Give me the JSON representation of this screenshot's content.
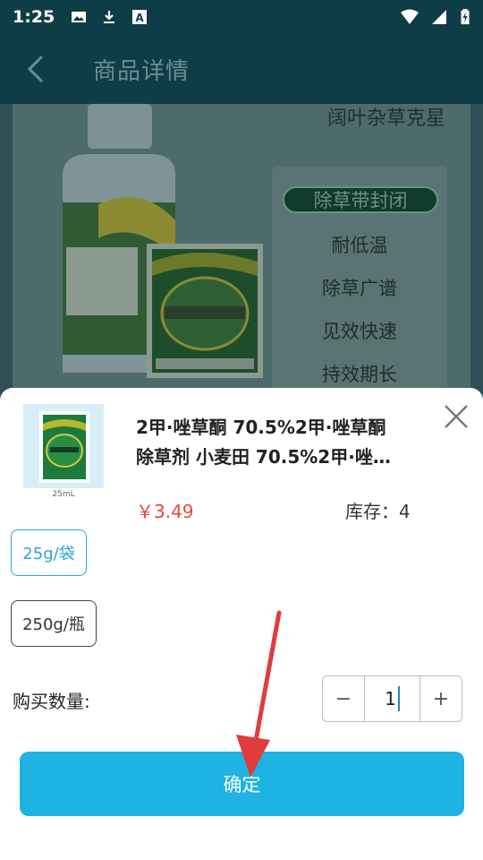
{
  "status_bar": {
    "time": "1:25",
    "left_icons": [
      "image-icon",
      "download-icon",
      "text-a-icon"
    ],
    "right_icons": [
      "wifi-icon",
      "signal-icon",
      "battery-charging-icon"
    ]
  },
  "app_bar": {
    "title": "商品详情",
    "back_icon": "chevron-left-icon"
  },
  "hero": {
    "headline": "阔叶杂草克星",
    "feature_tag": "除草带封闭",
    "features": [
      "耐低温",
      "除草广谱",
      "见效快速",
      "持效期长"
    ]
  },
  "sheet": {
    "thumbnail_caption": "25mL",
    "product_name_line1": "2甲·唑草酮 70.5%2甲·唑草酮",
    "product_name_line2": "除草剂 小麦田 70.5%2甲·唑…",
    "price": "￥3.49",
    "stock_label": "库存：",
    "stock_value": "4",
    "specs": [
      "25g/袋",
      "250g/瓶"
    ],
    "selected_spec": "25g/袋",
    "quantity_label": "购买数量:",
    "quantity_value": "1",
    "minus_label": "−",
    "plus_label": "+",
    "confirm_label": "确定"
  },
  "colors": {
    "accent": "#1eb3e2",
    "price": "#e24a3c",
    "appbar": "#0f3d47",
    "annotation_arrow": "#e03c3c"
  }
}
